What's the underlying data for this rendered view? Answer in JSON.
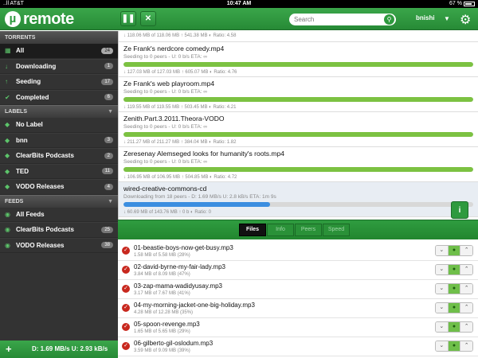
{
  "status_bar": {
    "carrier": "..ll AT&T",
    "time": "10:47 AM",
    "battery": "67 %"
  },
  "header": {
    "logo_mark": "µ",
    "logo_text": "remote",
    "pause_icon": "pause-icon",
    "stop_icon": "close-icon",
    "search_placeholder": "Search",
    "user": "bnishi"
  },
  "sidebar": {
    "torrents_header": "TORRENTS",
    "torrents": [
      {
        "label": "All",
        "count": "24",
        "icon": "grid-icon"
      },
      {
        "label": "Downloading",
        "count": "1",
        "icon": "arrow-down-icon"
      },
      {
        "label": "Seeding",
        "count": "17",
        "icon": "arrow-up-icon"
      },
      {
        "label": "Completed",
        "count": "6",
        "icon": "check-icon"
      }
    ],
    "labels_header": "LABELS",
    "labels": [
      {
        "label": "No Label",
        "count": ""
      },
      {
        "label": "bnn",
        "count": "3"
      },
      {
        "label": "ClearBits Podcasts",
        "count": "2"
      },
      {
        "label": "TED",
        "count": "11"
      },
      {
        "label": "VODO Releases",
        "count": "4"
      }
    ],
    "feeds_header": "FEEDS",
    "feeds": [
      {
        "label": "All Feeds",
        "count": ""
      },
      {
        "label": "ClearBits Podcasts",
        "count": "25"
      },
      {
        "label": "VODO Releases",
        "count": "38"
      }
    ]
  },
  "footer": {
    "add_label": "+",
    "speed": "D: 1.69 MB/s U: 2.93 kB/s"
  },
  "torrents": {
    "partial_stats": "↓ 118.06 MB of 118.06 MB  ↑ 541.38 MB  ◐ Ratio: 4.58",
    "items": [
      {
        "name": "Ze Frank's nerdcore comedy.mp4",
        "status": "Seeding to 0 peers - U: 0 b/s ETA: ∞",
        "progress": 100,
        "stats": "↓ 127.03 MB of 127.03 MB  ↑ 605.07 MB  ◐ Ratio: 4.76"
      },
      {
        "name": "Ze Frank's web playroom.mp4",
        "status": "Seeding to 0 peers - U: 0 b/s ETA: ∞",
        "progress": 100,
        "stats": "↓ 119.55 MB of 119.55 MB  ↑ 503.45 MB  ◐ Ratio: 4.21"
      },
      {
        "name": "Zenith.Part.3.2011.Theora-VODO",
        "status": "Seeding to 0 peers - U: 0 b/s ETA: ∞",
        "progress": 100,
        "stats": "↓ 211.27 MB of 211.27 MB  ↑ 384.04 MB  ◐ Ratio: 1.82"
      },
      {
        "name": "Zeresenay Alemseged looks for humanity's roots.mp4",
        "status": "Seeding to 0 peers - U: 0 b/s ETA: ∞",
        "progress": 100,
        "stats": "↓ 106.95 MB of 106.95 MB  ↑ 504.85 MB  ◐ Ratio: 4.72"
      },
      {
        "name": "wired-creative-commons-cd",
        "status": "Downloading from 18 peers - D: 1.69 MB/s U: 2.8 kB/s ETA: 1m 9s",
        "progress": 42,
        "stats": "↓ 60.69 MB of 143.76 MB  ↑ 0 b  ◐ Ratio: 0"
      }
    ]
  },
  "detail": {
    "info_label": "i",
    "tabs": [
      "Files",
      "Info",
      "Peers",
      "Speed"
    ],
    "controls": [
      "⌄",
      "●",
      "⌃"
    ],
    "files": [
      {
        "name": "01-beastie-boys-now-get-busy.mp3",
        "size": "1.58 MB of 5.58 MB (28%)"
      },
      {
        "name": "02-david-byrne-my-fair-lady.mp3",
        "size": "3.84 MB of 8.09 MB (47%)"
      },
      {
        "name": "03-zap-mama-wadidyusay.mp3",
        "size": "3.17 MB of 7.67 MB (41%)"
      },
      {
        "name": "04-my-morning-jacket-one-big-holiday.mp3",
        "size": "4.28 MB of 12.28 MB (35%)"
      },
      {
        "name": "05-spoon-revenge.mp3",
        "size": "1.65 MB of 5.65 MB (29%)"
      },
      {
        "name": "06-gilberto-gil-oslodum.mp3",
        "size": "3.59 MB of 9.09 MB (39%)"
      }
    ]
  },
  "colors": {
    "brand_green": "#2e9a3e",
    "progress_green": "#7cc242",
    "progress_blue": "#3b8ee0",
    "sidebar_bg": "#333333"
  }
}
